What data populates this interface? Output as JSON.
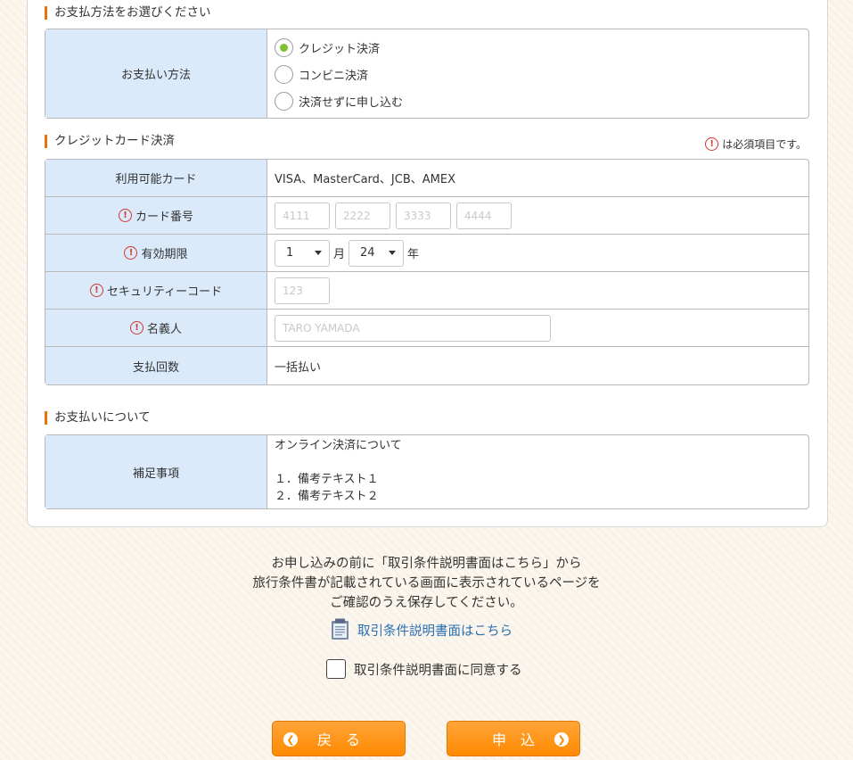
{
  "payment_method_section": {
    "title": "お支払方法をお選びください",
    "label": "お支払い方法",
    "options": [
      {
        "label": "クレジット決済",
        "selected": true
      },
      {
        "label": "コンビニ決済",
        "selected": false
      },
      {
        "label": "決済せずに申し込む",
        "selected": false
      }
    ]
  },
  "credit_section": {
    "title": "クレジットカード決済",
    "required_note": "は必須項目です。",
    "rows": {
      "cards": {
        "label": "利用可能カード",
        "value": "VISA、MasterCard、JCB、AMEX"
      },
      "card_number": {
        "label": "カード番号",
        "placeholders": [
          "4111",
          "2222",
          "3333",
          "4444"
        ]
      },
      "expiry": {
        "label": "有効期限",
        "month": "1",
        "month_unit": "月",
        "year": "24",
        "year_unit": "年"
      },
      "security_code": {
        "label": "セキュリティーコード",
        "placeholder": "123"
      },
      "holder": {
        "label": "名義人",
        "placeholder": "TARO YAMADA"
      },
      "installments": {
        "label": "支払回数",
        "value": "一括払い"
      }
    }
  },
  "payment_info_section": {
    "title": "お支払いについて",
    "label": "補足事項",
    "lines": [
      "オンライン決済について",
      "",
      "１．備考テキスト１",
      "２．備考テキスト２"
    ]
  },
  "notice": {
    "lines": [
      "お申し込みの前に「取引条件説明書面はこちら」から",
      "旅行条件書が記載されている画面に表示されているページを",
      "ご確認のうえ保存してください。"
    ],
    "link_label": "取引条件説明書面はこちら",
    "agree_label": "取引条件説明書面に同意する"
  },
  "buttons": {
    "back": "戻　る",
    "submit": "申　込"
  },
  "colors": {
    "accent": "#ff8a00",
    "header_cell": "#daeafb",
    "radio_on": "#7cc12f",
    "required": "#d4372c",
    "link": "#2a6fb3"
  }
}
